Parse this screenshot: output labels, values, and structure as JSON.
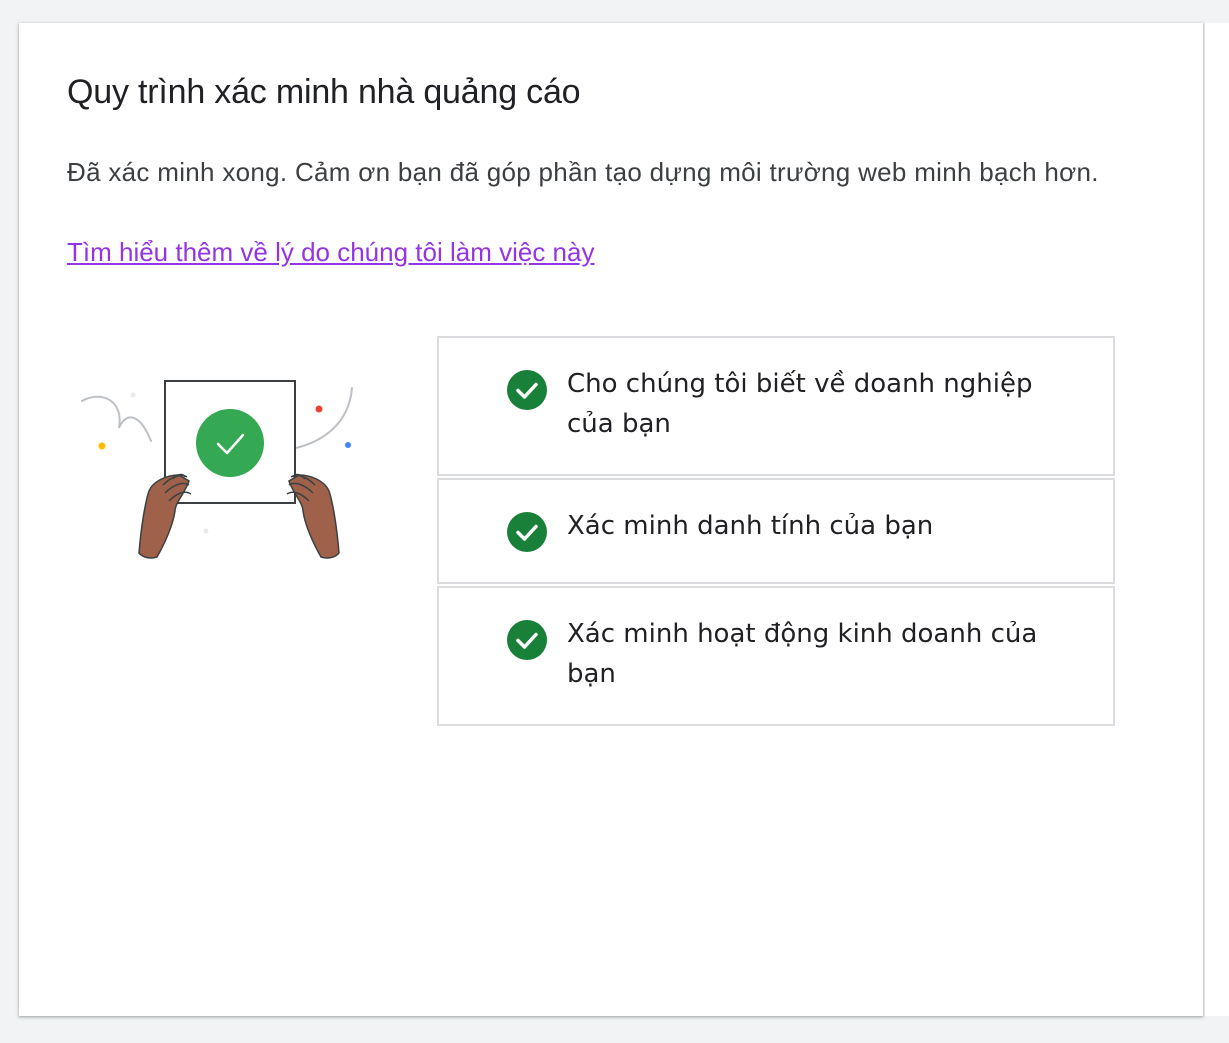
{
  "page": {
    "title": "Quy trình xác minh nhà quảng cáo",
    "description": "Đã xác minh xong. Cảm ơn bạn đã góp phần tạo dựng môi trường web minh bạch hơn.",
    "learn_more_link": "Tìm hiểu thêm về lý do chúng tôi làm việc này"
  },
  "steps": [
    {
      "label": "Cho chúng tôi biết về doanh nghiệp của bạn",
      "status": "completed",
      "icon": "check-circle-icon"
    },
    {
      "label": "Xác minh danh tính của bạn",
      "status": "completed",
      "icon": "check-circle-icon"
    },
    {
      "label": "Xác minh hoạt động kinh doanh của bạn",
      "status": "completed",
      "icon": "check-circle-icon"
    }
  ],
  "colors": {
    "check": "#188038",
    "illustration_check": "#34a853",
    "link": "#9334e6",
    "skin": "#a0614a"
  }
}
